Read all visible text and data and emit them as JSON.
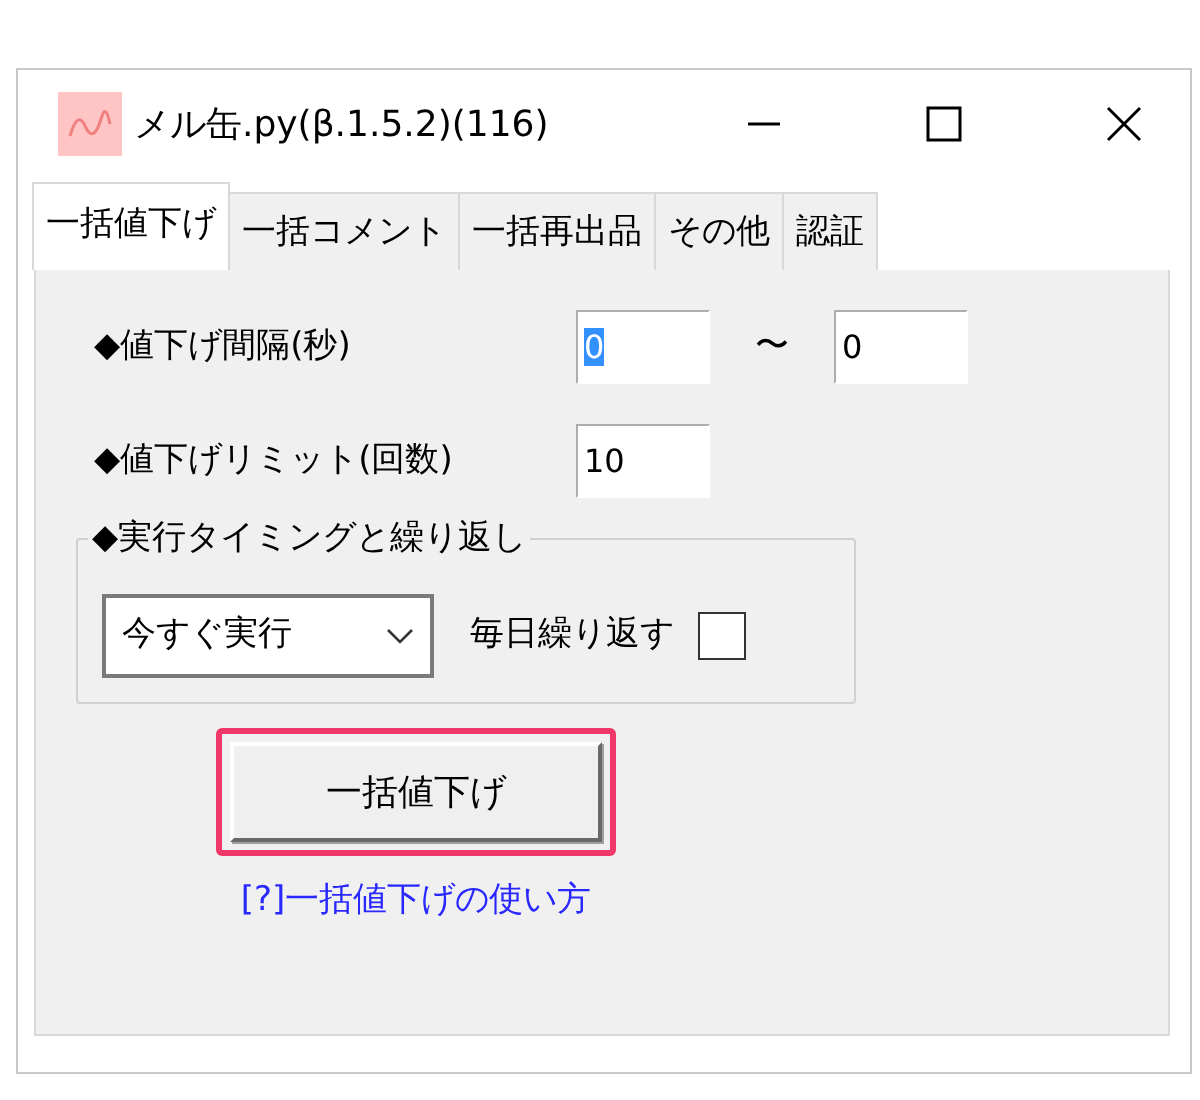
{
  "window": {
    "title": "メル缶.py(β.1.5.2)(116)"
  },
  "tabs": [
    {
      "label": "一括値下げ",
      "selected": true
    },
    {
      "label": "一括コメント",
      "selected": false
    },
    {
      "label": "一括再出品",
      "selected": false
    },
    {
      "label": "その他",
      "selected": false
    },
    {
      "label": "認証",
      "selected": false
    }
  ],
  "interval": {
    "label": "◆値下げ間隔(秒)",
    "min_value": "0",
    "min_text_selected": true,
    "separator": "〜",
    "max_value": "0"
  },
  "limit": {
    "label": "◆値下げリミット(回数)",
    "value": "10"
  },
  "timing_group": {
    "legend": "◆実行タイミングと繰り返し",
    "dropdown_value": "今すぐ実行",
    "repeat_label": "毎日繰り返す",
    "repeat_checked": false
  },
  "action_button": {
    "label": "一括値下げ",
    "highlighted": true
  },
  "help_link": "[?]一括値下げの使い方"
}
